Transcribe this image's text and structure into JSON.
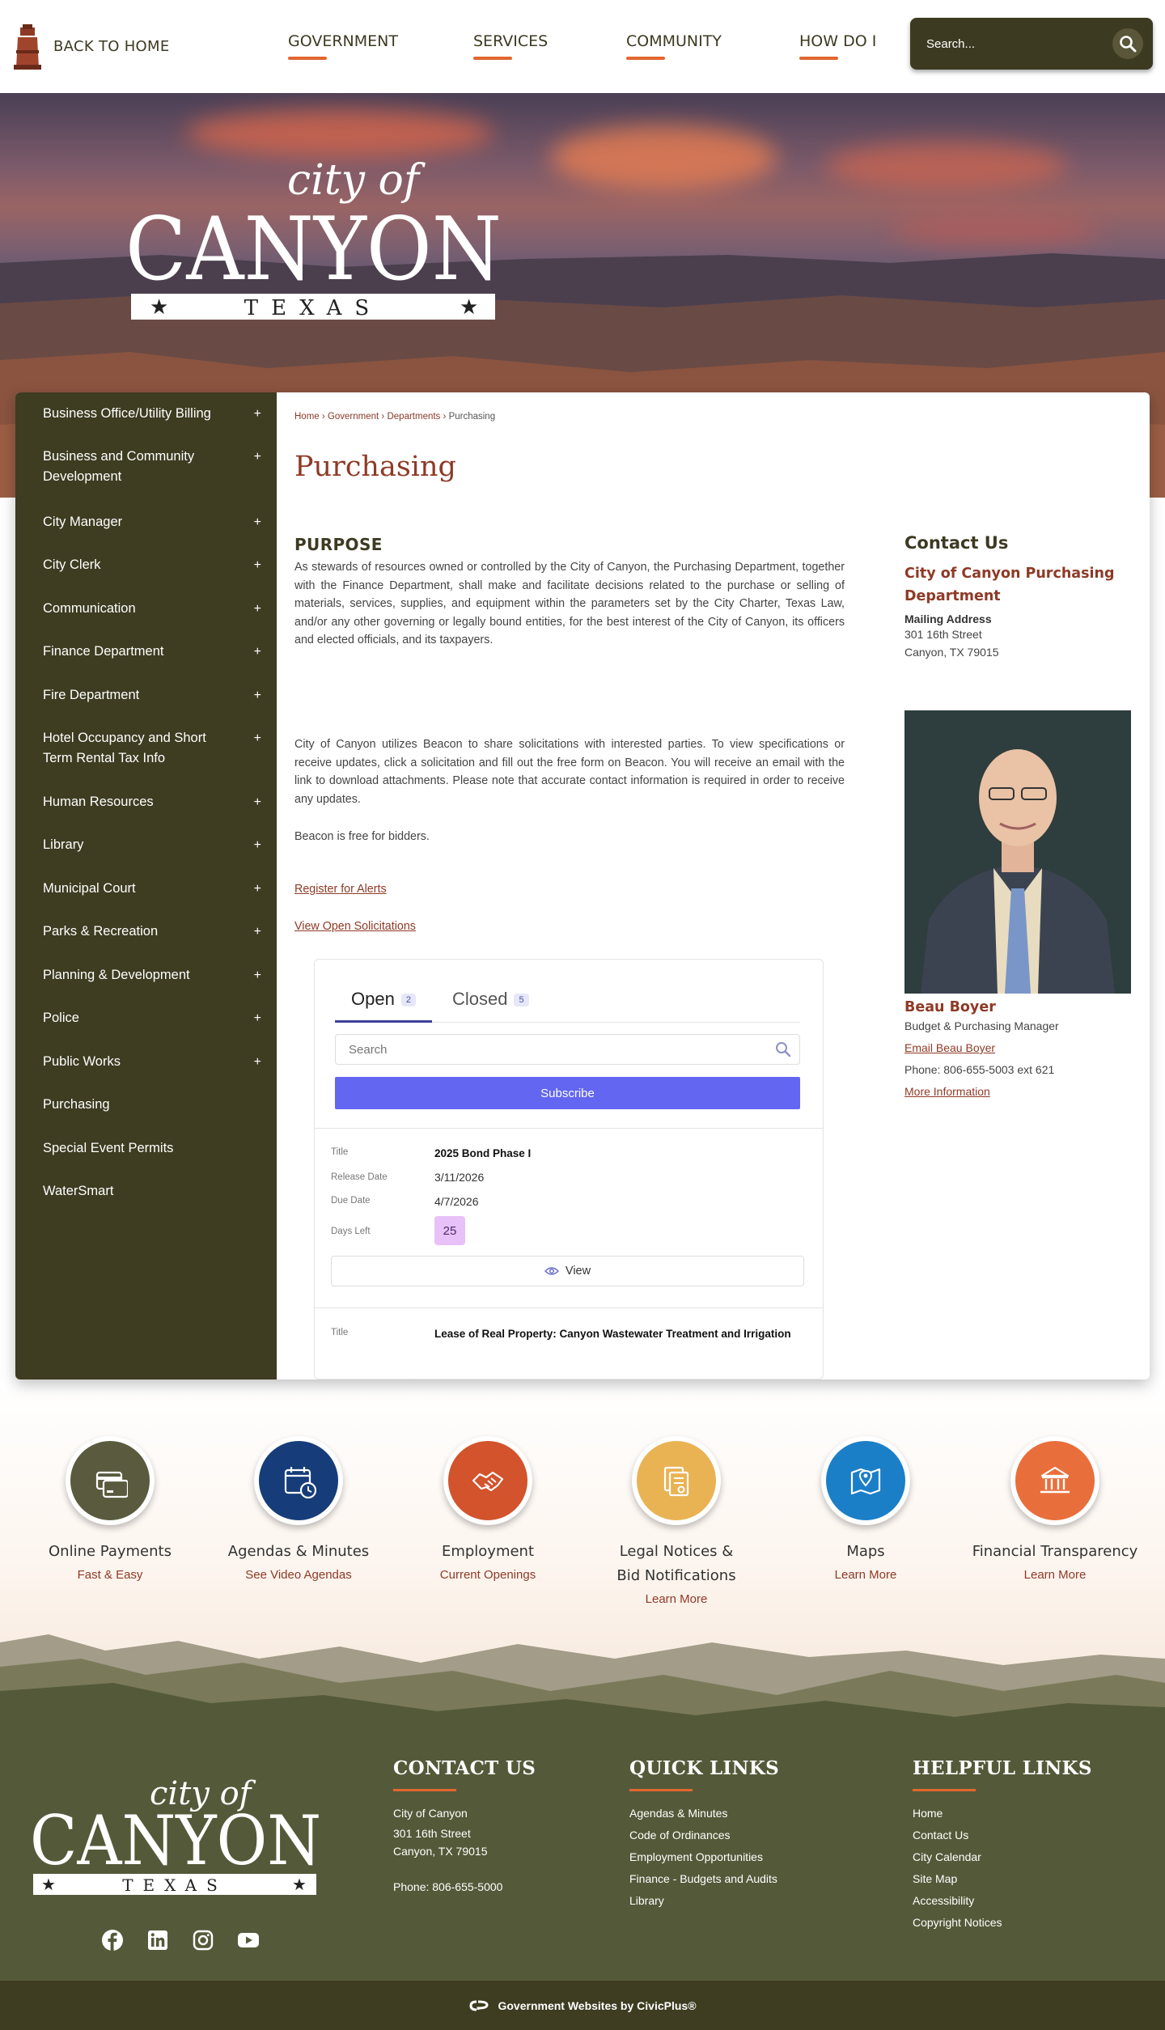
{
  "header": {
    "back_home": "BACK TO HOME",
    "nav": [
      "GOVERNMENT",
      "SERVICES",
      "COMMUNITY",
      "HOW DO I"
    ],
    "search_placeholder": "Search..."
  },
  "hero": {
    "logo_small": "city of",
    "logo_big": "CANYON",
    "logo_state": "TEXAS"
  },
  "sidebar": {
    "items": [
      {
        "label": "Business Office/Utility Billing",
        "expandable": true
      },
      {
        "label": "Business and Community Development",
        "expandable": true
      },
      {
        "label": "City Manager",
        "expandable": true
      },
      {
        "label": "City Clerk",
        "expandable": true
      },
      {
        "label": "Communication",
        "expandable": true
      },
      {
        "label": "Finance Department",
        "expandable": true
      },
      {
        "label": "Fire Department",
        "expandable": true
      },
      {
        "label": "Hotel Occupancy and Short Term Rental Tax Info",
        "expandable": true
      },
      {
        "label": "Human Resources",
        "expandable": true
      },
      {
        "label": "Library",
        "expandable": true
      },
      {
        "label": "Municipal Court",
        "expandable": true
      },
      {
        "label": "Parks & Recreation",
        "expandable": true
      },
      {
        "label": "Planning & Development",
        "expandable": true
      },
      {
        "label": "Police",
        "expandable": true
      },
      {
        "label": "Public Works",
        "expandable": true
      },
      {
        "label": "Purchasing",
        "expandable": false
      },
      {
        "label": "Special Event Permits",
        "expandable": false
      },
      {
        "label": "WaterSmart",
        "expandable": false
      }
    ],
    "plus": "+"
  },
  "breadcrumb": {
    "items": [
      "Home",
      "Government",
      "Departments"
    ],
    "current": "Purchasing",
    "sep": "›"
  },
  "page": {
    "title": "Purchasing",
    "purpose_heading": "PURPOSE",
    "purpose_text": "As stewards of resources owned or controlled by the City of Canyon, the Purchasing Department, together with the Finance Department, shall make and facilitate decisions related to the purchase or selling of materials, services, supplies, and equipment within the parameters set by the City Charter, Texas Law, and/or any other governing or legally bound entities, for the best interest of the City of Canyon, its officers and elected officials, and its taxpayers.",
    "beacon_text": "City of Canyon utilizes Beacon to share solicitations with interested parties. To view specifications or receive updates, click a solicitation and fill out the free form on Beacon. You will receive an email with the link to download attachments. Please note that accurate contact information is required in order to receive any updates.",
    "beacon_free": "Beacon is free for bidders.",
    "register_link": "Register for Alerts",
    "view_link": "View Open Solicitations"
  },
  "bids": {
    "tabs": [
      {
        "label": "Open",
        "count": "2"
      },
      {
        "label": "Closed",
        "count": "5"
      }
    ],
    "search_placeholder": "Search",
    "subscribe": "Subscribe",
    "labels": {
      "title": "Title",
      "release": "Release Date",
      "due": "Due Date",
      "days": "Days Left"
    },
    "view_label": "View",
    "items": [
      {
        "title": "2025 Bond Phase I",
        "release": "3/11/2026",
        "due": "4/7/2026",
        "days_left": "25"
      },
      {
        "title": "Lease of Real Property: Canyon Wastewater Treatment and Irrigation"
      }
    ]
  },
  "contact": {
    "heading": "Contact Us",
    "dept": "City of Canyon Purchasing Department",
    "mailing_head": "Mailing Address",
    "street": "301 16th Street",
    "city": "Canyon, TX 79015"
  },
  "person": {
    "name": "Beau Boyer",
    "role": "Budget & Purchasing Manager",
    "email_link": "Email Beau Boyer",
    "phone": "Phone: 806-655-5003 ext 621",
    "more_link": "More Information"
  },
  "quick_links": [
    {
      "title": "Online Payments",
      "sub": "Fast & Easy",
      "color": "#5a5b3e",
      "icon": "credit-card-icon"
    },
    {
      "title": "Agendas & Minutes",
      "sub": "See Video Agendas",
      "color": "#163d7a",
      "icon": "calendar-clock-icon"
    },
    {
      "title": "Employment",
      "sub": "Current Openings",
      "color": "#d2532c",
      "icon": "handshake-icon"
    },
    {
      "title": "Legal Notices & Bid Notifications",
      "sub": "Learn More",
      "color": "#e9b354",
      "icon": "documents-icon"
    },
    {
      "title": "Maps",
      "sub": "Learn More",
      "color": "#1b7fc7",
      "icon": "map-icon"
    },
    {
      "title": "Financial Transparency",
      "sub": "Learn More",
      "color": "#e86f3c",
      "icon": "bank-icon"
    }
  ],
  "footer": {
    "contact": {
      "heading": "CONTACT US",
      "lines": [
        "City of Canyon",
        "301 16th Street",
        "Canyon, TX 79015"
      ],
      "phone": "Phone: 806-655-5000"
    },
    "quick": {
      "heading": "QUICK LINKS",
      "links": [
        "Agendas & Minutes",
        "Code of Ordinances",
        "Employment Opportunities",
        "Finance - Budgets and Audits",
        "Library"
      ]
    },
    "helpful": {
      "heading": "HELPFUL LINKS",
      "links": [
        "Home",
        "Contact Us",
        "City Calendar",
        "Site Map",
        "Accessibility",
        "Copyright Notices"
      ]
    },
    "social": [
      "facebook-icon",
      "linkedin-icon",
      "instagram-icon",
      "youtube-icon"
    ],
    "credit": "Government Websites by CivicPlus®"
  },
  "colors": {
    "brand_olive": "#3e3c21",
    "accent_orange": "#e2672f",
    "link_brown": "#8e3a26",
    "footer_green": "#545a39"
  }
}
